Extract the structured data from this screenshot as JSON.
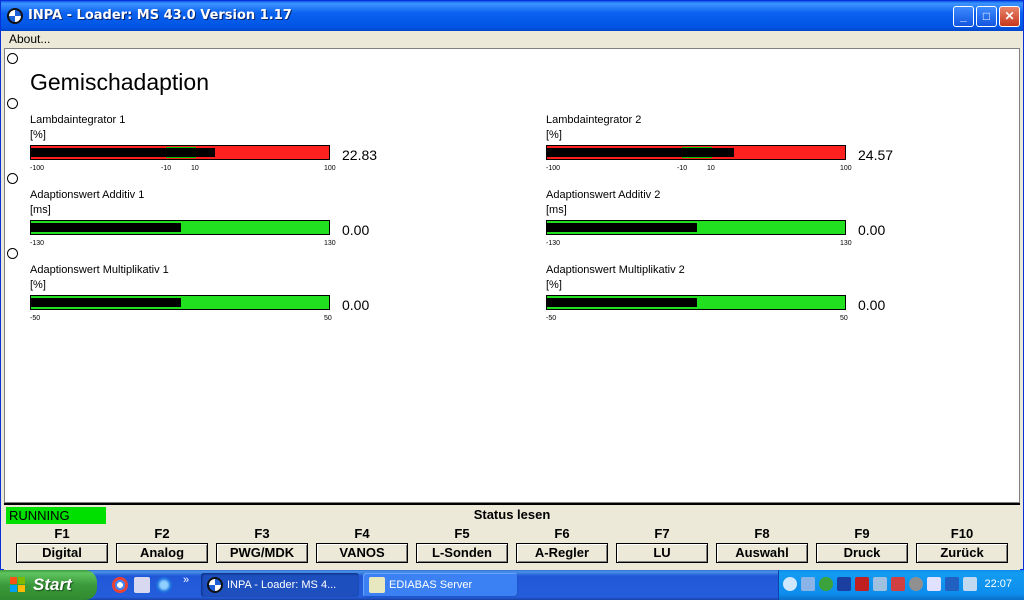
{
  "window": {
    "title": "INPA - Loader:  MS 43.0 Version 1.17",
    "minimize": "_",
    "maximize": "□",
    "close": "✕"
  },
  "menu": {
    "about": "About..."
  },
  "page": {
    "heading": "Gemischadaption",
    "meters": [
      {
        "label": "Lambdaintegrator 1",
        "unit": "[%]",
        "value": "22.83",
        "min": -100,
        "max": 100,
        "current": 22.83,
        "color": "#ff2020",
        "band": [
          -10,
          10
        ],
        "ticks": [
          "-100",
          "-10",
          "10",
          "100"
        ]
      },
      {
        "label": "Lambdaintegrator 2",
        "unit": "[%]",
        "value": "24.57",
        "min": -100,
        "max": 100,
        "current": 24.57,
        "color": "#ff2020",
        "band": [
          -10,
          10
        ],
        "ticks": [
          "-100",
          "-10",
          "10",
          "100"
        ]
      },
      {
        "label": "Adaptionswert Additiv 1",
        "unit": "[ms]",
        "value": "0.00",
        "min": -130,
        "max": 130,
        "current": 0.0,
        "color": "#20e020",
        "band": null,
        "ticks": [
          "-130",
          "130"
        ]
      },
      {
        "label": "Adaptionswert Additiv 2",
        "unit": "[ms]",
        "value": "0.00",
        "min": -130,
        "max": 130,
        "current": 0.0,
        "color": "#20e020",
        "band": null,
        "ticks": [
          "-130",
          "130"
        ]
      },
      {
        "label": "Adaptionswert Multiplikativ 1",
        "unit": "[%]",
        "value": "0.00",
        "min": -50,
        "max": 50,
        "current": 0.0,
        "color": "#20e020",
        "band": null,
        "ticks": [
          "-50",
          "50"
        ]
      },
      {
        "label": "Adaptionswert Multiplikativ 2",
        "unit": "[%]",
        "value": "0.00",
        "min": -50,
        "max": 50,
        "current": 0.0,
        "color": "#20e020",
        "band": null,
        "ticks": [
          "-50",
          "50"
        ]
      }
    ]
  },
  "status": {
    "state": "RUNNING",
    "text": "Status lesen",
    "state_color": "#00e000"
  },
  "fkeys": [
    {
      "key": "F1",
      "label": "Digital"
    },
    {
      "key": "F2",
      "label": "Analog"
    },
    {
      "key": "F3",
      "label": "PWG/MDK"
    },
    {
      "key": "F4",
      "label": "VANOS"
    },
    {
      "key": "F5",
      "label": "L-Sonden"
    },
    {
      "key": "F6",
      "label": "A-Regler"
    },
    {
      "key": "F7",
      "label": "LU"
    },
    {
      "key": "F8",
      "label": "Auswahl"
    },
    {
      "key": "F9",
      "label": "Druck"
    },
    {
      "key": "F10",
      "label": "Zurück"
    }
  ],
  "taskbar": {
    "start": "Start",
    "chevron": "»",
    "tasks": [
      {
        "label": "INPA - Loader:  MS 4...",
        "icon": "bmw-icon",
        "active": true
      },
      {
        "label": "EDIABAS Server",
        "icon": "ediabas-icon",
        "active": false
      }
    ],
    "clock": "22:07"
  }
}
